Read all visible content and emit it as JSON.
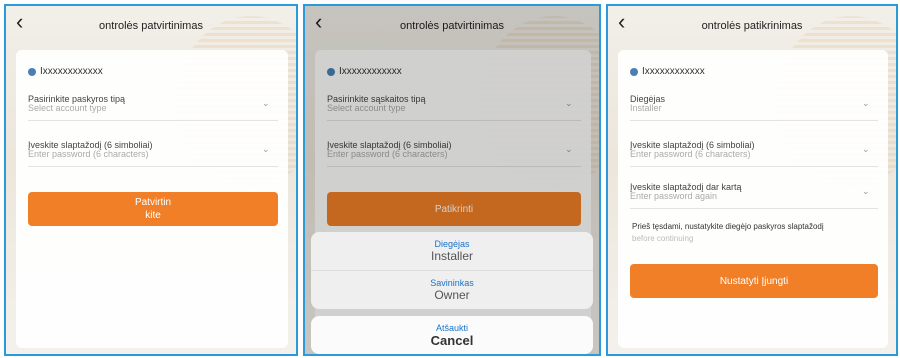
{
  "panel1": {
    "title": "ontrolės patvirtinimas",
    "account": "Ixxxxxxxxxxxx",
    "field1_label": "Pasirinkite paskyros tipą",
    "field1_placeholder": "Select account type",
    "field2_label": "Įveskite slaptažodį (6 simboliai)",
    "field2_placeholder": "Enter password (6 characters)",
    "button_line1": "Patvirtin",
    "button_line2": "kite"
  },
  "panel2": {
    "title": "ontrolės patvirtinimas",
    "account": "Ixxxxxxxxxxxx",
    "field1_label": "Pasirinkite sąskaitos tipą",
    "field1_placeholder": "Select account type",
    "field2_label": "Įveskite slaptažodį (6 simboliai)",
    "field2_placeholder": "Enter password (6 characters)",
    "button": "Patikrinti",
    "sheet": [
      {
        "lt": "Diegėjas",
        "en": "Installer"
      },
      {
        "lt": "Savininkas",
        "en": "Owner"
      }
    ],
    "cancel_lt": "Atšaukti",
    "cancel_en": "Cancel"
  },
  "panel3": {
    "title": "ontrolės patikrinimas",
    "account": "Ixxxxxxxxxxxx",
    "field1_value": "Diegėjas",
    "field1_placeholder": "Installer",
    "field2_label": "Įveskite slaptažodį (6 simboliai)",
    "field2_placeholder": "Enter password (6 characters)",
    "field3_label": "Įveskite slaptažodį dar kartą",
    "field3_placeholder": "Enter password again",
    "note": "Prieš tęsdami, nustatykite diegėjo paskyros slaptažodį",
    "note_faded": "before continuing",
    "button": "Nustatyti Įjungti"
  },
  "colors": {
    "accent": "#f07f27",
    "frame": "#2a9ad8",
    "link": "#1a73c9"
  }
}
